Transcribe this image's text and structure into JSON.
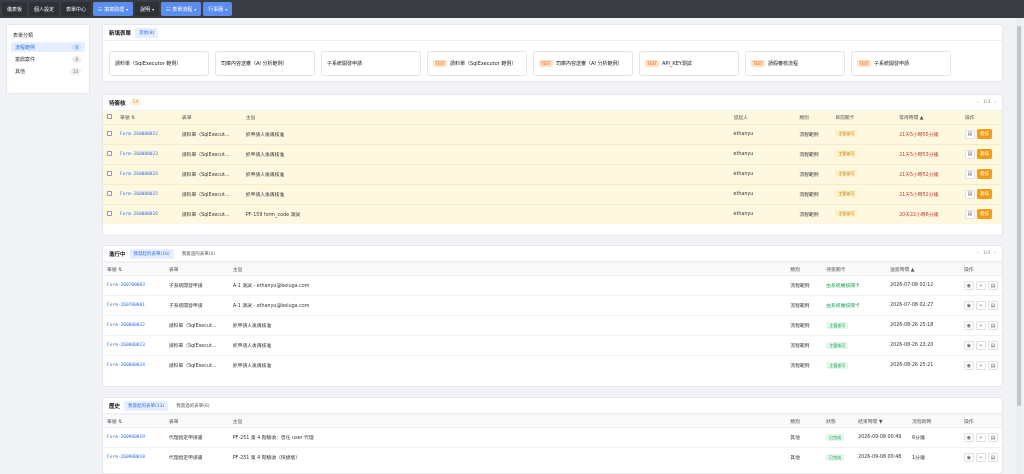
{
  "nav": {
    "items": [
      {
        "label": "儀表板",
        "style": "dark",
        "chevron": false
      },
      {
        "label": "個人設定",
        "style": "dark",
        "chevron": false
      },
      {
        "label": "表單中心",
        "style": "dark",
        "chevron": false
      },
      {
        "label": "☷ 填寫助理",
        "style": "blue",
        "chevron": true
      },
      {
        "label": "說明",
        "style": "dark",
        "chevron": true
      },
      {
        "label": "☷ 表單流程",
        "style": "blue",
        "chevron": true
      },
      {
        "label": "行事曆",
        "style": "blue",
        "chevron": true
      }
    ]
  },
  "sidebar": {
    "title": "表單分類",
    "items": [
      {
        "label": "流程範例",
        "count": "6",
        "active": true
      },
      {
        "label": "富鼎案件",
        "count": "0",
        "active": false
      },
      {
        "label": "其他",
        "count": "13",
        "active": false
      }
    ]
  },
  "new_forms": {
    "title": "新填表單",
    "tab": "其他(8)",
    "cards": [
      {
        "label": "請料單（SqlExecutor 範例）",
        "test": ""
      },
      {
        "label": "司庫內容送審（AI 分析範例）",
        "test": ""
      },
      {
        "label": "子系統開發申請",
        "test": ""
      },
      {
        "label": "請料單（SqlExecutor 範例）",
        "test": "TEST"
      },
      {
        "label": "司庫內容送審（AI 分析範例）",
        "test": "TEST"
      },
      {
        "label": "API_KEY測試",
        "test": "TEST"
      },
      {
        "label": "請假審核流程",
        "test": "TEST"
      },
      {
        "label": "子系統開發申請",
        "test": "TEST"
      }
    ]
  },
  "pending": {
    "title": "待簽核",
    "count": "14",
    "pager": "1/3",
    "headers": [
      "單號 ⇅",
      "表單",
      "主旨",
      "發起人",
      "類別",
      "目前關卡",
      "等待時間 ▲",
      "操作"
    ],
    "rows": [
      {
        "id": "Form-260000022",
        "form": "請料單（SqlExecut…",
        "subject": "抓申請人後再核准",
        "initiator": "ethanyu",
        "category": "流程範例",
        "stage": "主管核可",
        "wait": "21天5小時55分鐘"
      },
      {
        "id": "Form-260000023",
        "form": "請料單（SqlExecut…",
        "subject": "抓申請人後再核准",
        "initiator": "ethanyu",
        "category": "流程範例",
        "stage": "主管核可",
        "wait": "21天5小時53分鐘"
      },
      {
        "id": "Form-260000024",
        "form": "請料單（SqlExecut…",
        "subject": "抓申請人後再核准",
        "initiator": "ethanyu",
        "category": "流程範例",
        "stage": "主管核可",
        "wait": "21天5小時52分鐘"
      },
      {
        "id": "Form-260000025",
        "form": "請料單（SqlExecut…",
        "subject": "抓申請人後再核准",
        "initiator": "ethanyu",
        "category": "流程範例",
        "stage": "主管核可",
        "wait": "21天5小時52分鐘"
      },
      {
        "id": "Form-260000026",
        "form": "請料單（SqlExecut…",
        "subject": "PF-159 form_code 測試",
        "initiator": "ethanyu",
        "category": "流程範例",
        "stage": "主管核可",
        "wait": "20天22小時6分鐘"
      }
    ],
    "sign_label": "簽核"
  },
  "progress": {
    "title": "進行中",
    "tab_active": "我發起的表單(16)",
    "tab_other": "我簽過的表單(0)",
    "pager": "1/4",
    "headers": [
      "單號 ⇅",
      "表單",
      "主旨",
      "類別",
      "待簽關卡",
      "送簽時間 ▲",
      "操作"
    ],
    "rows": [
      {
        "id": "Form-260700003",
        "form": "子系統開發申請",
        "subject": "A-1 測試 - ethanyu@beluga.com",
        "category": "流程範例",
        "stage": "由系統審核關卡",
        "time": "2026-07-08 02:12"
      },
      {
        "id": "Form-260700001",
        "form": "子系統開發申請",
        "subject": "A-1 測試 - ethanyu@beluga.com",
        "category": "流程範例",
        "stage": "由系統審核關卡",
        "time": "2026-07-08 02:27"
      },
      {
        "id": "Form-260000022",
        "form": "請料單（SqlExecut…",
        "subject": "抓申請人後再核准",
        "category": "流程範例",
        "stage": "主管核可",
        "time": "2026-08-26 25:18"
      },
      {
        "id": "Form-260000023",
        "form": "請料單（SqlExecut…",
        "subject": "抓申請人後再核准",
        "category": "流程範例",
        "stage": "主管核可",
        "time": "2026-08-26 23:20"
      },
      {
        "id": "Form-260000024",
        "form": "請料單（SqlExecut…",
        "subject": "抓申請人後再核准",
        "category": "流程範例",
        "stage": "主管核可",
        "time": "2026-08-26 25:21"
      }
    ]
  },
  "history": {
    "title": "歷史",
    "tab_active": "我發起的表單(13)",
    "tab_other": "我簽過的表單(6)",
    "headers": [
      "單號 ⇅",
      "表單",
      "主旨",
      "類別",
      "狀態",
      "結束時間 ▼",
      "流程耗時",
      "操作"
    ],
    "rows": [
      {
        "id": "Form-260900019",
        "form": "代理指定申請書",
        "subject": "PF-251 第 4 階驗收：曾任 user 代理",
        "category": "其他",
        "status": "已完成",
        "end": "2026-09-08 00:49",
        "duration": "6分鐘"
      },
      {
        "id": "Form-260900018",
        "form": "代理指定申請書",
        "subject": "PF-251 第 4 階驗收（快捷版）",
        "category": "其他",
        "status": "已完成",
        "end": "2026-09-08 00:48",
        "duration": "1分鐘"
      }
    ]
  }
}
